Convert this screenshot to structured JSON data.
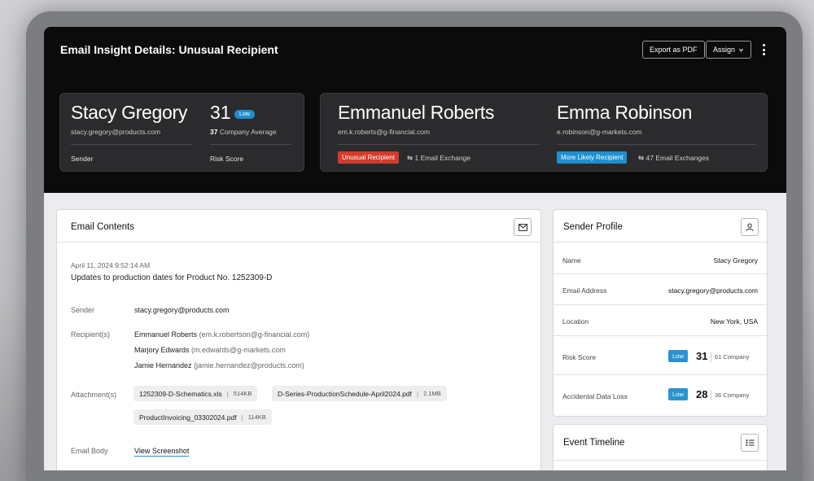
{
  "header": {
    "title": "Email Insight Details: Unusual Recipient",
    "export_label": "Export as PDF",
    "assign_label": "Assign"
  },
  "sender_card": {
    "name": "Stacy Gregory",
    "email": "stacy.gregory@products.com",
    "role_label": "Sender",
    "risk_score": "31",
    "risk_level": "Low",
    "company_avg_value": "37",
    "company_avg_label": "Company Average",
    "risk_label": "Risk Score"
  },
  "recipients_card": {
    "r1": {
      "name": "Emmanuel Roberts",
      "email": "em.k.roberts@g-financial.com",
      "tag": "Unusual Recipient",
      "exchange": "1 Email Exchange"
    },
    "r2": {
      "name": "Emma Robinson",
      "email": "e.robinson@g-markets.com",
      "tag": "More Likely Recipient",
      "exchange": "47 Email Exchanges"
    }
  },
  "email_contents": {
    "title": "Email Contents",
    "timestamp": "April 11, 2024 9:52:14 AM",
    "subject": "Updates to production dates for Product No. 1252309-D",
    "sender_label": "Sender",
    "sender_value": "stacy.gregory@products.com",
    "recipients_label": "Recipient(s)",
    "recipients": [
      {
        "name": "Emmanuel Roberts",
        "email": "(em.k.robertson@g-financial.com)"
      },
      {
        "name": "Marjory Edwards",
        "email": "(m.edwards@g-markets.com"
      },
      {
        "name": "Jamie Hernandez",
        "email": "(jamie.hernandez@products.com)"
      }
    ],
    "attachments_label": "Attachment(s)",
    "attachments": [
      {
        "name": "1252309-D-Schematics.xls",
        "size": "514KB"
      },
      {
        "name": "D-Series-ProductionSchedule-April2024.pdf",
        "size": "2.1MB"
      },
      {
        "name": "ProductInvoicing_03302024.pdf",
        "size": "114KB"
      }
    ],
    "body_label": "Email Body",
    "body_link": "View Screenshot"
  },
  "sender_profile": {
    "title": "Sender Profile",
    "rows": [
      {
        "label": "Name",
        "value": "Stacy Gregory"
      },
      {
        "label": "Email Address",
        "value": "stacy.gregory@products.com"
      },
      {
        "label": "Location",
        "value": "New York, USA"
      }
    ],
    "risk": {
      "label": "Risk Score",
      "level": "Low",
      "score": "31",
      "company": "61 Company"
    },
    "dataloss": {
      "label": "Accidental Data Loss",
      "level": "Low",
      "score": "28",
      "company": "36 Company"
    }
  },
  "event_timeline": {
    "title": "Event Timeline"
  },
  "colors": {
    "accent_blue": "#1f8fcf",
    "alert_red": "#d33b2c",
    "header_bg": "#0b0b0c"
  }
}
